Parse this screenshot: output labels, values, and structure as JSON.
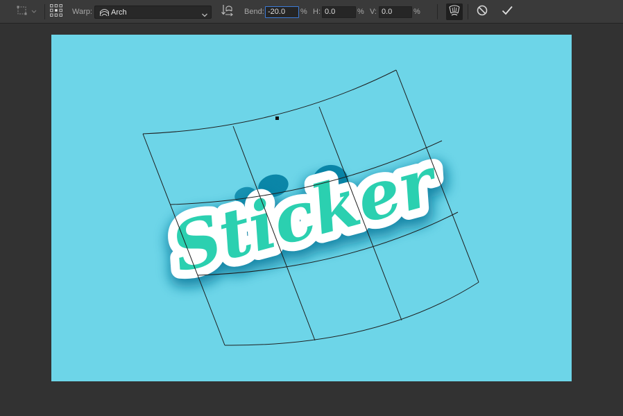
{
  "toolbar": {
    "warp_label": "Warp:",
    "warp_style": "Arch",
    "bend_label": "Bend:",
    "bend_value": "-20.0",
    "bend_unit": "%",
    "h_label": "H:",
    "h_value": "0.0",
    "h_unit": "%",
    "v_label": "V:",
    "v_value": "0.0",
    "v_unit": "%"
  },
  "canvas": {
    "background_color": "#6dd5e8",
    "sticker_text": "Sticker",
    "sticker_text_color": "#2bd0b0",
    "sticker_outline_color": "#ffffff",
    "shadow_color": "#0b7fa0"
  },
  "icons": {
    "tool_preset": "transform-tool-icon",
    "grid_toggle": "warp-grid-icon",
    "warp_style": "arch-icon",
    "orientation": "change-warp-orientation-icon",
    "mode_toggle": "warp-mode-toggle-icon",
    "cancel": "cancel-transform-icon",
    "commit": "commit-transform-icon"
  }
}
